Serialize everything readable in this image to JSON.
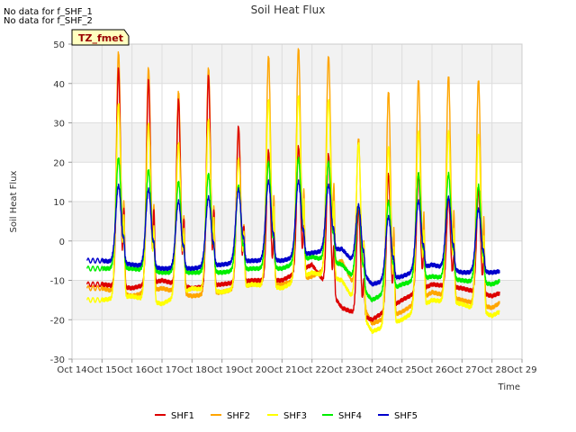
{
  "messages": [
    "No data for f_SHF_1",
    "No data for f_SHF_2"
  ],
  "badge": "TZ_fmet",
  "chart_data": {
    "type": "line",
    "title": "Soil Heat Flux",
    "xlabel": "Time",
    "ylabel": "Soil Heat Flux",
    "xlim": [
      14,
      29
    ],
    "ylim": [
      -30,
      50
    ],
    "x_ticks": [
      "Oct 14",
      "Oct 15",
      "Oct 16",
      "Oct 17",
      "Oct 18",
      "Oct 19",
      "Oct 20",
      "Oct 21",
      "Oct 22",
      "Oct 23",
      "Oct 24",
      "Oct 25",
      "Oct 26",
      "Oct 27",
      "Oct 28",
      "Oct 29"
    ],
    "y_ticks": [
      -30,
      -20,
      -10,
      0,
      10,
      20,
      30,
      40,
      50
    ],
    "grid": true,
    "banded_background": true,
    "legend_position": "bottom",
    "days": [
      14.5,
      15,
      16,
      17,
      18,
      19,
      20,
      21,
      22,
      23,
      24,
      25,
      26,
      27,
      28,
      28.25
    ],
    "series": [
      {
        "name": "SHF1",
        "color": "#dd0000",
        "peaks": [
          null,
          44,
          41,
          36,
          42,
          29,
          23,
          24,
          22,
          8,
          17,
          17,
          11,
          13,
          15
        ],
        "troughs": [
          -8,
          -11,
          -12,
          -10,
          -12,
          -11,
          -10,
          -10,
          -6,
          -17,
          -20,
          -15,
          -11,
          -12,
          -14,
          -11
        ]
      },
      {
        "name": "SHF2",
        "color": "#ffa500",
        "peaks": [
          null,
          48,
          44,
          38,
          44,
          29,
          47,
          49,
          47,
          26,
          38,
          41,
          42,
          41,
          40
        ],
        "troughs": [
          -8,
          -12,
          -14,
          -12,
          -14,
          -13,
          -11,
          -11,
          -9,
          -5,
          -21,
          -18,
          -13,
          -15,
          -17,
          -12
        ]
      },
      {
        "name": "SHF3",
        "color": "#ffff00",
        "peaks": [
          null,
          35,
          30,
          25,
          31,
          21,
          36,
          37,
          36,
          25,
          24,
          28,
          28,
          27,
          27
        ],
        "troughs": [
          -12,
          -15,
          -14,
          -16,
          -12,
          -13,
          -11,
          -12,
          -8,
          -10,
          -23,
          -20,
          -15,
          -16,
          -19,
          -15
        ]
      },
      {
        "name": "SHF4",
        "color": "#00ee00",
        "peaks": [
          null,
          21,
          18,
          15,
          17,
          14,
          20,
          21,
          20,
          9,
          10,
          17,
          17,
          14,
          17
        ],
        "troughs": [
          -6,
          -7,
          -7,
          -8,
          -8,
          -8,
          -7,
          -7,
          -4,
          -6,
          -15,
          -11,
          -9,
          -10,
          -11,
          -8
        ]
      },
      {
        "name": "SHF5",
        "color": "#0000cc",
        "peaks": [
          null,
          14,
          13,
          10,
          11,
          13,
          15,
          15,
          14,
          9,
          6,
          10,
          11,
          8,
          9
        ],
        "troughs": [
          -6,
          -5,
          -6,
          -7,
          -7,
          -6,
          -5,
          -5,
          -3,
          -2,
          -11,
          -9,
          -6,
          -8,
          -8,
          -7
        ]
      }
    ]
  }
}
